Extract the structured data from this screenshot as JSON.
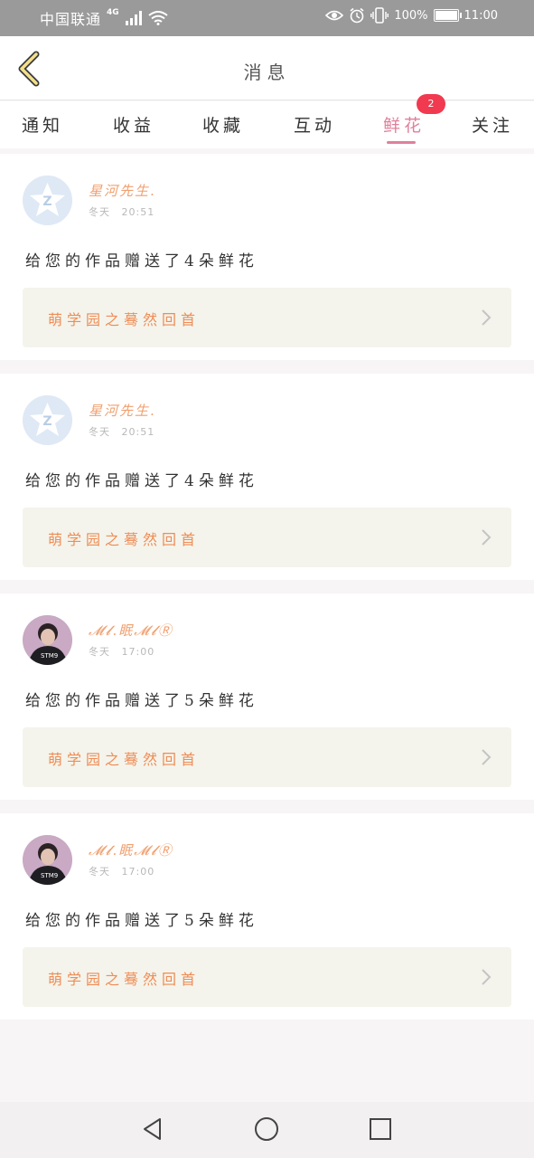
{
  "status_bar": {
    "carrier": "中国联通",
    "network": "4G",
    "battery_text": "100%",
    "battery_level": 1.0,
    "time": "11:00"
  },
  "header": {
    "title": "消息"
  },
  "tabs": [
    {
      "label": "通知",
      "active": false
    },
    {
      "label": "收益",
      "active": false
    },
    {
      "label": "收藏",
      "active": false
    },
    {
      "label": "互动",
      "active": false
    },
    {
      "label": "鲜花",
      "active": true,
      "badge": "2"
    },
    {
      "label": "关注",
      "active": false
    }
  ],
  "notifications": [
    {
      "username": "星河先生.",
      "gender": "冬天",
      "time": "20:51",
      "message": "给您的作品赠送了4朵鲜花",
      "work_title": "萌学园之蓦然回首",
      "avatar": "default-avatar"
    },
    {
      "username": "星河先生.",
      "gender": "冬天",
      "time": "20:51",
      "message": "给您的作品赠送了4朵鲜花",
      "work_title": "萌学园之蓦然回首",
      "avatar": "default-avatar"
    },
    {
      "username": "𝓜𝓵.眠𝓜𝓵Ⓡ",
      "gender": "冬天",
      "time": "17:00",
      "message": "给您的作品赠送了5朵鲜花",
      "work_title": "萌学园之蓦然回首",
      "avatar": "photo-avatar"
    },
    {
      "username": "𝓜𝓵.眠𝓜𝓵Ⓡ",
      "gender": "冬天",
      "time": "17:00",
      "message": "给您的作品赠送了5朵鲜花",
      "work_title": "萌学园之蓦然回首",
      "avatar": "photo-avatar"
    }
  ],
  "nav_bar": {
    "buttons": [
      "back-triangle-icon",
      "home-circle-icon",
      "recents-square-icon"
    ]
  },
  "colors": {
    "accent": "#e0809b",
    "username": "#f0a070",
    "work_title": "#ef8c55",
    "badge": "#f1394f",
    "back_arrow": "#f3e08a"
  }
}
